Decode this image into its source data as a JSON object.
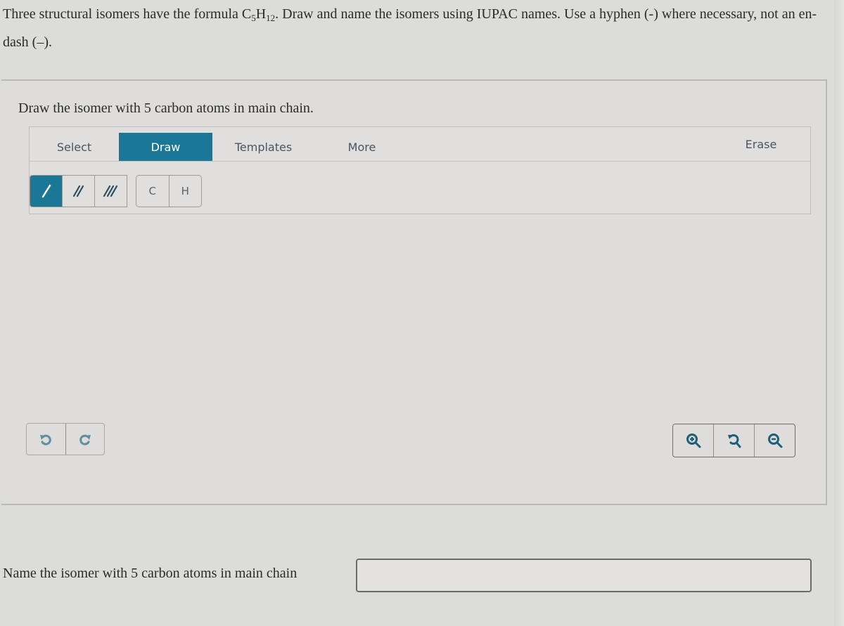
{
  "question": {
    "prompt_part1": "Three structural isomers have the formula C",
    "sub_c": "5",
    "prompt_part2": "H",
    "sub_h": "12",
    "prompt_part3": ". Draw and name the isomers using IUPAC names. Use a hyphen (-) where necessary, not an en-dash (–)."
  },
  "draw_panel": {
    "title": "Draw the isomer with 5 carbon atoms in main chain.",
    "menu": {
      "tabs": [
        {
          "label": "Select",
          "active": false
        },
        {
          "label": "Draw",
          "active": true
        },
        {
          "label": "Templates",
          "active": false
        },
        {
          "label": "More",
          "active": false
        }
      ],
      "erase_label": "Erase"
    },
    "bond_tools": [
      {
        "icon": "single-bond-icon",
        "active": true
      },
      {
        "icon": "double-bond-icon",
        "active": false
      },
      {
        "icon": "triple-bond-icon",
        "active": false
      }
    ],
    "atom_tools": [
      {
        "label": "C"
      },
      {
        "label": "H"
      }
    ],
    "history_tools": [
      "undo-icon",
      "redo-icon"
    ],
    "zoom_tools": [
      "zoom-in-icon",
      "zoom-reset-icon",
      "zoom-out-icon"
    ],
    "accent_color": "#1a7896"
  },
  "name_field": {
    "label": "Name the isomer with 5 carbon atoms in main chain",
    "value": "",
    "placeholder": ""
  }
}
